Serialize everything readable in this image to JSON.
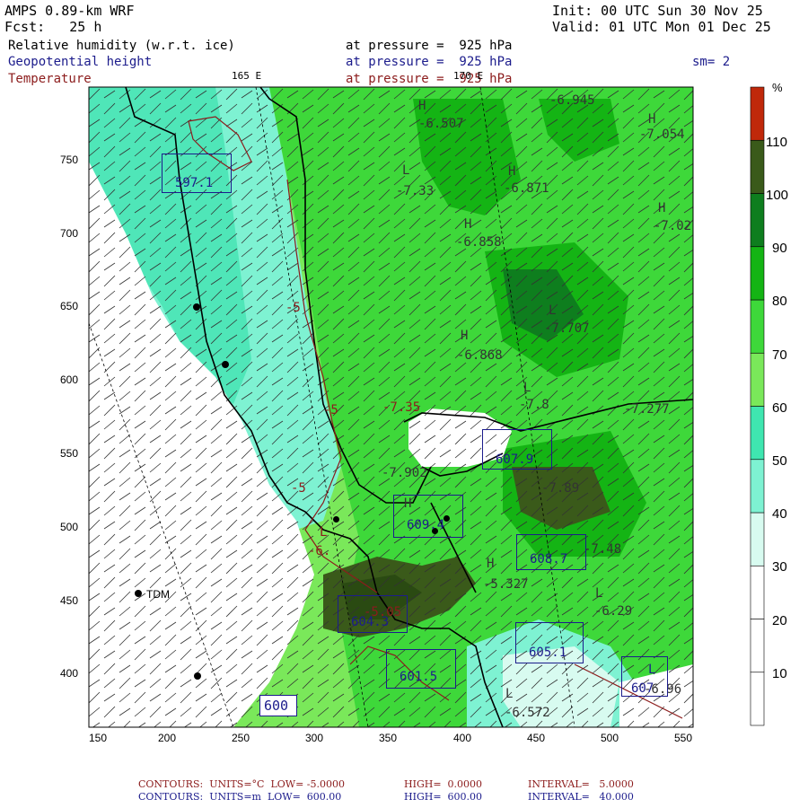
{
  "header": {
    "model": "AMPS 0.89-km WRF",
    "init": "Init: 00 UTC Sun 30 Nov 25",
    "fcst": "Fcst:   25 h",
    "valid": "Valid: 01 UTC Mon 01 Dec 25",
    "field1": "Relative humidity (w.r.t. ice)",
    "field1_level": "at pressure =  925 hPa",
    "field2": "Geopotential height",
    "field2_level": "at pressure =  925 hPa",
    "smoothing": "sm= 2",
    "field3": "Temperature",
    "field3_level": "at pressure =  925 hPa",
    "lon_165": "165 E",
    "lon_170": "170 E"
  },
  "colorbar": {
    "unit": "%",
    "ticks": [
      "10",
      "20",
      "30",
      "40",
      "50",
      "60",
      "70",
      "80",
      "90",
      "100",
      "110"
    ],
    "colors": [
      "#ffffff",
      "#ffffff",
      "#ffffff",
      "#d8fbf0",
      "#7ef2d2",
      "#3fe6b0",
      "#7ae85a",
      "#3ed83a",
      "#14b414",
      "#0e7e1e",
      "#3a5a1a",
      "#c0280a"
    ]
  },
  "axes": {
    "x_ticks": [
      "150",
      "200",
      "250",
      "300",
      "350",
      "400",
      "450",
      "500",
      "550"
    ],
    "y_ticks": [
      "750",
      "700",
      "650",
      "600",
      "550",
      "500",
      "450",
      "400"
    ]
  },
  "map_labels": {
    "station": "TDM",
    "highs": [
      "H",
      "H",
      "H",
      "H",
      "H",
      "H",
      "H",
      "H"
    ],
    "lows": [
      "L",
      "L",
      "L",
      "L",
      "L",
      "L",
      "L"
    ],
    "temperature_values": [
      "-6.507",
      "-6.945",
      "-7.054",
      "-7.33",
      "-6.871",
      "-7.02",
      "-6.858",
      "-7.707",
      "-6.868",
      "-7.8",
      "-7.277",
      "-7.35",
      "-7.902",
      "-7.89",
      "-6.",
      "-5.327",
      "-7.48",
      "-5.05",
      "-6.29",
      "-6.572",
      "-6.96",
      "-5",
      "-5",
      "-5"
    ],
    "height_boxes": [
      "607.9",
      "609.4",
      "608.7",
      "604.3",
      "605.1",
      "601.5",
      "607",
      "600",
      "597.1"
    ]
  },
  "footer": {
    "line1": {
      "contours": "CONTOURS:  UNITS=°C  LOW= -5.0000",
      "high": "HIGH=  0.0000",
      "interval": "INTERVAL=   5.0000"
    },
    "line2": {
      "contours": "CONTOURS:  UNITS=m  LOW=  600.00",
      "high": "HIGH=  600.00",
      "interval": "INTERVAL=   40.000"
    }
  }
}
